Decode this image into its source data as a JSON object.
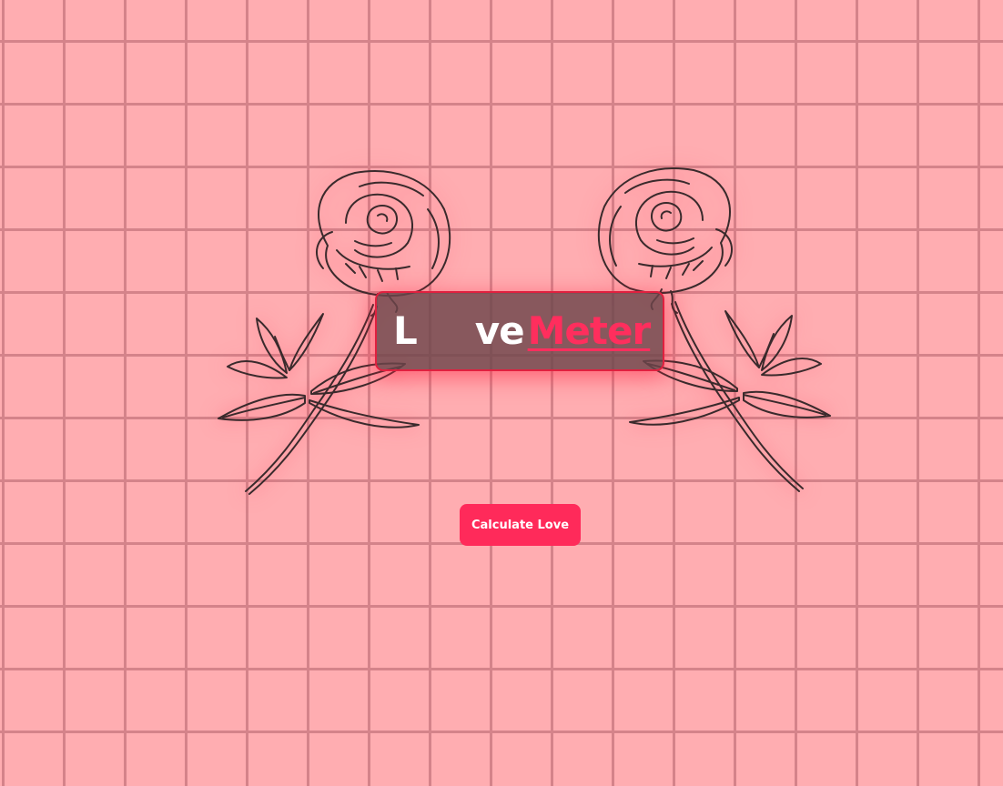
{
  "title": {
    "part_l": "L",
    "part_ve": "ve",
    "part_meter": "Meter"
  },
  "calculate_button": {
    "label": "Calculate Love"
  },
  "decorations": {
    "left_image": "rose-line-drawing-icon",
    "right_image": "rose-line-drawing-icon"
  },
  "colors": {
    "background": "#ffadb1",
    "grid_lines": "#d4838a",
    "accent": "#ff2a5a",
    "title_box": "#6e464a",
    "title_box_border": "#e0203f"
  }
}
